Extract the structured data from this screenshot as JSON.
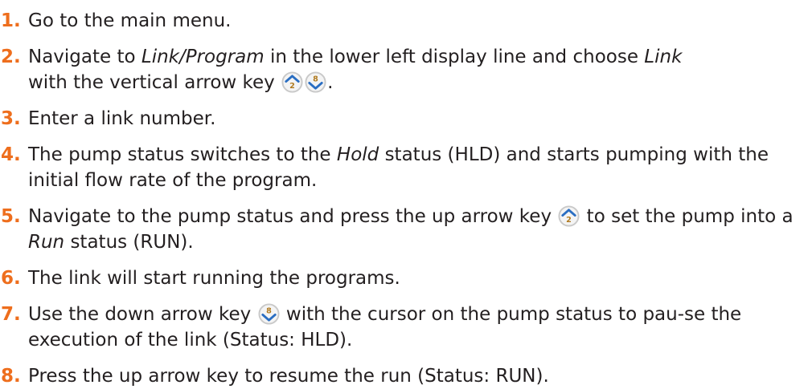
{
  "colors": {
    "step_number": "#ee6e1d",
    "text": "#231f20",
    "key_ring": "#c9c9c9",
    "key_arrow": "#2a6ec2"
  },
  "icons": {
    "up_key": "up-arrow-key-2-icon",
    "down_key": "down-arrow-key-8-icon"
  },
  "key_labels": {
    "up": "2",
    "down": "8"
  },
  "steps": [
    {
      "num": "1.",
      "text_a": "Go to the main menu."
    },
    {
      "num": "2.",
      "text_a": "Navigate to ",
      "em_a": "Link/Program",
      "text_b": " in the lower left display line and choose ",
      "em_b": "Link",
      "text_c": "with the vertical arrow key ",
      "text_d": "."
    },
    {
      "num": "3.",
      "text_a": "Enter a link number."
    },
    {
      "num": "4.",
      "text_a": "The pump status switches to the ",
      "em_a": "Hold",
      "text_b": " status (HLD) and starts pumping with the initial flow rate of the program."
    },
    {
      "num": "5.",
      "text_a": "Navigate to the pump status and press the up arrow key ",
      "text_b": " to set the pump into a ",
      "em_a": "Run",
      "text_c": " status (RUN)."
    },
    {
      "num": "6.",
      "text_a": "The link will start running the programs."
    },
    {
      "num": "7.",
      "text_a": "Use the down arrow key ",
      "text_b": " with the cursor on the pump status to pau-se the execution of the link (Status: HLD)."
    },
    {
      "num": "8.",
      "text_a": "Press the up arrow key to resume the run (Status: RUN)."
    }
  ]
}
